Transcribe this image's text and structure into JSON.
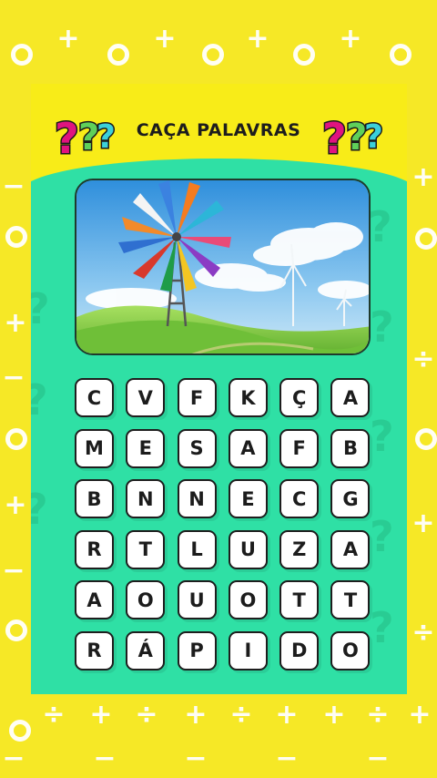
{
  "game": {
    "title": "CAÇA PALAVRAS",
    "icons": [
      "question-marks-left",
      "question-marks-right",
      "windmill-landscape-image"
    ],
    "colors": {
      "background": "#f6e826",
      "card": "#2fe0a5",
      "header": "#f8ec18",
      "q_magenta": "#e0147f",
      "q_green": "#5fd05a",
      "q_cyan": "#3cd0d9"
    },
    "grid": [
      [
        "C",
        "V",
        "F",
        "K",
        "Ç",
        "A"
      ],
      [
        "M",
        "E",
        "S",
        "A",
        "F",
        "B"
      ],
      [
        "B",
        "N",
        "N",
        "E",
        "C",
        "G"
      ],
      [
        "R",
        "T",
        "L",
        "U",
        "Z",
        "A"
      ],
      [
        "A",
        "O",
        "U",
        "O",
        "T",
        "T"
      ],
      [
        "R",
        "Á",
        "P",
        "I",
        "D",
        "O"
      ]
    ]
  }
}
